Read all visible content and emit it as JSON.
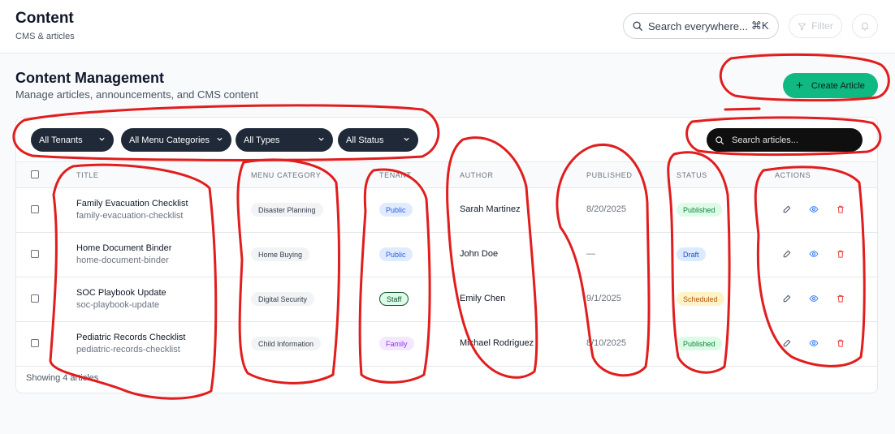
{
  "header": {
    "title": "Content",
    "subtitle": "CMS & articles",
    "search_placeholder": "Search everywhere...",
    "search_shortcut": "⌘K",
    "filter_label": "Filter"
  },
  "page": {
    "title": "Content Management",
    "description": "Manage articles, announcements, and CMS content",
    "create_label": "Create Article"
  },
  "filters": {
    "tenants": "All Tenants",
    "menu_categories": "All Menu Categories",
    "types": "All Types",
    "status": "All Status",
    "search_placeholder": "Search articles..."
  },
  "table": {
    "columns": [
      "TITLE",
      "MENU CATEGORY",
      "TENANT",
      "AUTHOR",
      "PUBLISHED",
      "STATUS",
      "ACTIONS"
    ],
    "rows": [
      {
        "title": "Family Evacuation Checklist",
        "slug": "family-evacuation-checklist",
        "category": "Disaster Planning",
        "tenant": "Public",
        "author": "Sarah Martinez",
        "published": "8/20/2025",
        "status": "Published"
      },
      {
        "title": "Home Document Binder",
        "slug": "home-document-binder",
        "category": "Home Buying",
        "tenant": "Public",
        "author": "John Doe",
        "published": "—",
        "status": "Draft"
      },
      {
        "title": "SOC Playbook Update",
        "slug": "soc-playbook-update",
        "category": "Digital Security",
        "tenant": "Staff",
        "author": "Emily Chen",
        "published": "9/1/2025",
        "status": "Scheduled"
      },
      {
        "title": "Pediatric Records Checklist",
        "slug": "pediatric-records-checklist",
        "category": "Child Information",
        "tenant": "Family",
        "author": "Michael Rodriguez",
        "published": "8/10/2025",
        "status": "Published"
      }
    ],
    "footer": "Showing 4 articles"
  },
  "icons": {
    "search": "search-icon",
    "filter": "filter-icon",
    "bell": "bell-icon",
    "edit": "edit-icon",
    "view": "eye-icon",
    "delete": "trash-icon",
    "plus": "plus-icon",
    "chevron": "chevron-down-icon"
  },
  "colors": {
    "accent": "#10b981",
    "annotation": "#e11d1d",
    "view_icon": "#3b82f6",
    "delete_icon": "#ef4444"
  }
}
